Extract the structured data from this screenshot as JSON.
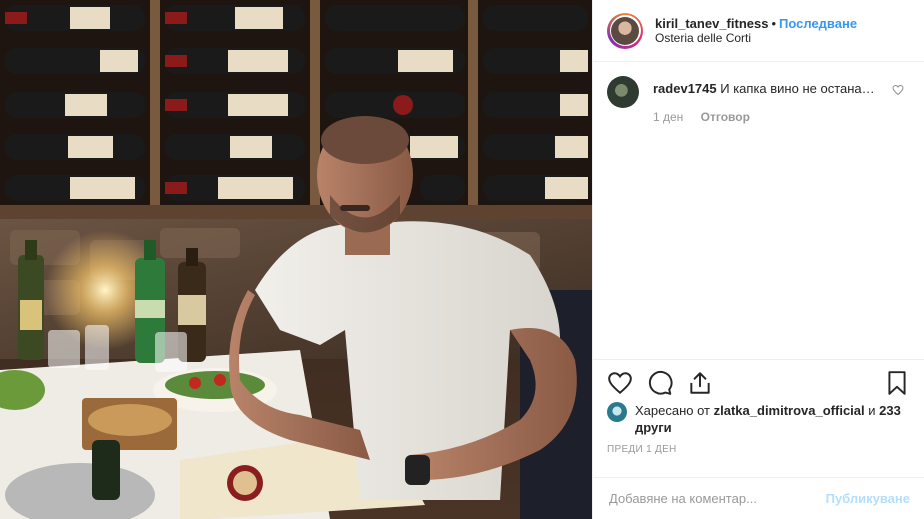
{
  "header": {
    "username": "kiril_tanev_fitness",
    "dot": "•",
    "follow_label": "Последване",
    "location": "Osteria delle Corti"
  },
  "comment": {
    "username": "radev1745",
    "text": "И капка вино не остана…",
    "age": "1 ден",
    "reply_label": "Отговор"
  },
  "likes": {
    "prefix": "Харесано от",
    "user": "zlatka_dimitrova_official",
    "suffix": "и",
    "others": "233 други"
  },
  "post_time": "ПРЕДИ 1 ДЕН",
  "add_comment": {
    "placeholder": "Добавяне на коментар...",
    "post_label": "Публикуване"
  },
  "icons": {
    "like": "heart-icon",
    "comment": "comment-bubble-icon",
    "share": "share-icon",
    "save": "bookmark-icon",
    "comment_like": "small-heart-icon"
  },
  "colors": {
    "link_blue": "#3897f0",
    "post_button_disabled": "#b2dffc",
    "muted_text": "#999999"
  }
}
